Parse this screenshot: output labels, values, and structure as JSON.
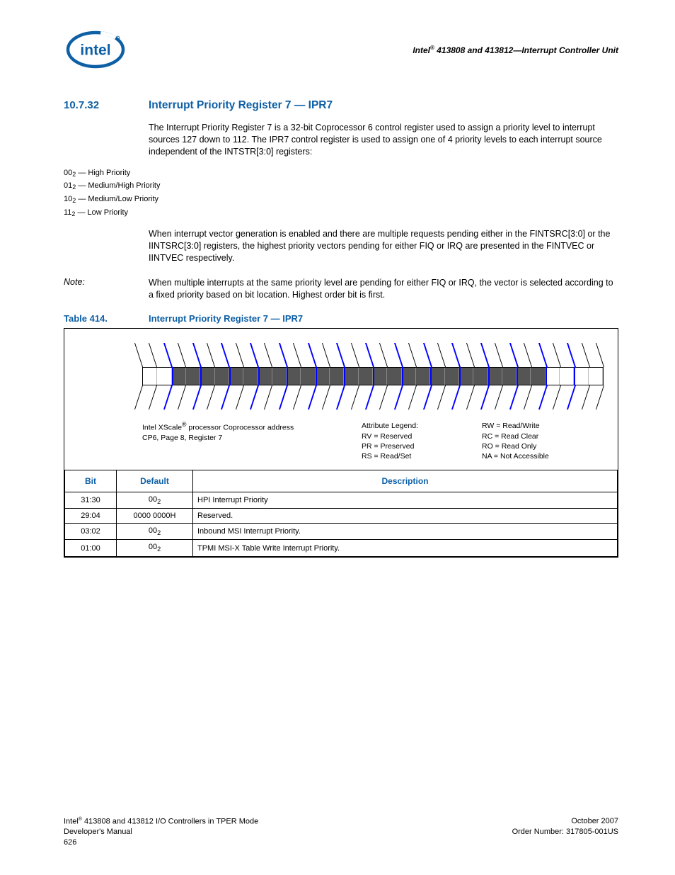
{
  "header": {
    "doc_title_html": "Intel<sup>®</sup> 413808 and 413812—Interrupt Controller Unit"
  },
  "section": {
    "number": "10.7.32",
    "title": "Interrupt Priority Register 7 — IPR7",
    "para1": "The Interrupt Priority Register 7 is a 32-bit Coprocessor 6 control register used to assign a priority level to interrupt sources 127 down to 112. The IPR7 control register is used to assign one of 4 priority levels to each interrupt source independent of the INTSTR[3:0] registers:",
    "priority_list": [
      {
        "code": "00",
        "sub": "2",
        "dash": " — ",
        "label": "High Priority"
      },
      {
        "code": "01",
        "sub": "2",
        "dash": " — ",
        "label": "Medium/High Priority"
      },
      {
        "code": "10",
        "sub": "2",
        "dash": " — ",
        "label": "Medium/Low Priority"
      },
      {
        "code": "11",
        "sub": "2",
        "dash": " — ",
        "label": "Low Priority"
      }
    ],
    "para2": "When interrupt vector generation is enabled and there are multiple requests pending either in the FINTSRC[3:0] or the IINTSRC[3:0] registers, the highest priority vectors pending for either FIQ or IRQ are presented in the FINTVEC or IINTVEC respectively.",
    "note_label": "Note:",
    "note_body": "When multiple interrupts at the same priority level are pending for either FIQ or IRQ, the vector is selected according to a fixed priority based on bit location. Highest order bit is first."
  },
  "table_caption": {
    "num": "Table 414.",
    "title": "Interrupt Priority Register 7 — IPR7"
  },
  "legend": {
    "addr_line1_html": "Intel XScale<sup>®</sup> processor Coprocessor address",
    "addr_line2": "CP6, Page 8, Register 7",
    "attr_title": "Attribute Legend:",
    "attrs_left": [
      "RV = Reserved",
      "PR = Preserved",
      "RS = Read/Set"
    ],
    "attrs_right": [
      "RW = Read/Write",
      "RC = Read Clear",
      "RO = Read Only",
      "NA = Not Accessible"
    ]
  },
  "bit_table": {
    "headers": {
      "bit": "Bit",
      "default": "Default",
      "desc": "Description"
    },
    "rows": [
      {
        "bit": "31:30",
        "default_html": "00<sub>2</sub>",
        "desc": "HPI Interrupt Priority"
      },
      {
        "bit": "29:04",
        "default_html": "0000 0000H",
        "desc": "Reserved."
      },
      {
        "bit": "03:02",
        "default_html": "00<sub>2</sub>",
        "desc": "Inbound MSI Interrupt Priority."
      },
      {
        "bit": "01:00",
        "default_html": "00<sub>2</sub>",
        "desc": "TPMI MSI-X Table Write Interrupt Priority."
      }
    ]
  },
  "bitstrip": {
    "cells": [
      "white",
      "white",
      "dark",
      "dark",
      "dark",
      "dark",
      "dark",
      "dark",
      "dark",
      "dark",
      "dark",
      "dark",
      "dark",
      "dark",
      "dark",
      "dark",
      "dark",
      "dark",
      "dark",
      "dark",
      "dark",
      "dark",
      "dark",
      "dark",
      "dark",
      "dark",
      "dark",
      "dark",
      "white",
      "white",
      "white",
      "white"
    ],
    "blue_dividers": [
      2,
      4,
      6,
      8,
      10,
      12,
      14,
      16,
      18,
      20,
      22,
      24,
      26,
      28,
      30
    ]
  },
  "footer": {
    "left_line1_html": "Intel<sup>®</sup> 413808 and 413812 I/O Controllers in TPER Mode",
    "left_line2": "Developer's Manual",
    "left_line3": "626",
    "right_line1": "October 2007",
    "right_line2": "Order Number: 317805-001US"
  }
}
